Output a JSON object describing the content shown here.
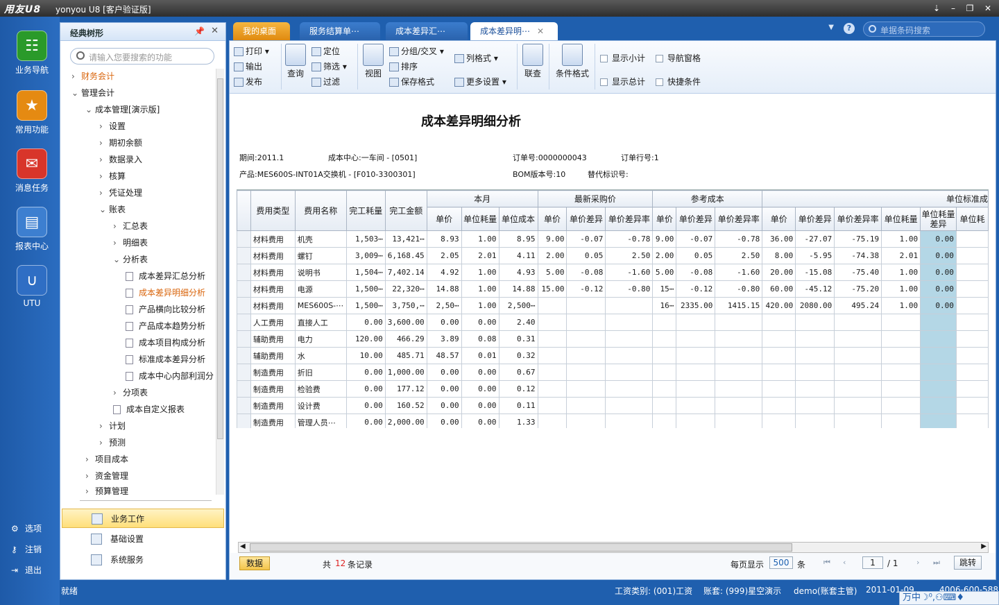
{
  "window": {
    "logo": "用友U8",
    "title": "yonyou U8 [客户验证版]",
    "controls": [
      "⇣",
      "–",
      "❐",
      "✕"
    ]
  },
  "leftnav": {
    "items": [
      {
        "label": "业务导航",
        "icon": "business-nav-icon",
        "color": "#2a9a2a"
      },
      {
        "label": "常用功能",
        "icon": "star-icon",
        "color": "#e58a12"
      },
      {
        "label": "消息任务",
        "icon": "mail-icon",
        "color": "#d8352a"
      },
      {
        "label": "报表中心",
        "icon": "report-icon",
        "color": "#3d7fd0"
      },
      {
        "label": "UTU",
        "icon": "utu-icon",
        "color": "#2f6ec4"
      }
    ],
    "bottom": [
      "选项",
      "注销",
      "退出"
    ]
  },
  "tree": {
    "title": "经典树形",
    "search_placeholder": "请输入您要搜索的功能",
    "nodes": [
      {
        "label": "财务会计",
        "arrow": "›"
      },
      {
        "label": "管理会计",
        "arrow": "⌄"
      },
      {
        "label": "成本管理[演示版]",
        "arrow": "⌄"
      },
      {
        "label": "设置",
        "arrow": "›"
      },
      {
        "label": "期初余额",
        "arrow": "›"
      },
      {
        "label": "数据录入",
        "arrow": "›"
      },
      {
        "label": "核算",
        "arrow": "›"
      },
      {
        "label": "凭证处理",
        "arrow": "›"
      },
      {
        "label": "账表",
        "arrow": "⌄"
      },
      {
        "label": "汇总表",
        "arrow": "›"
      },
      {
        "label": "明细表",
        "arrow": "›"
      },
      {
        "label": "分析表",
        "arrow": "⌄"
      },
      {
        "label": "成本差异汇总分析",
        "arrow": ""
      },
      {
        "label": "成本差异明细分析",
        "arrow": ""
      },
      {
        "label": "产品横向比较分析",
        "arrow": ""
      },
      {
        "label": "产品成本趋势分析",
        "arrow": ""
      },
      {
        "label": "成本项目构成分析",
        "arrow": ""
      },
      {
        "label": "标准成本差异分析",
        "arrow": ""
      },
      {
        "label": "成本中心内部利润分",
        "arrow": ""
      },
      {
        "label": "分项表",
        "arrow": "›"
      },
      {
        "label": "成本自定义报表",
        "arrow": ""
      },
      {
        "label": "计划",
        "arrow": "›"
      },
      {
        "label": "预测",
        "arrow": "›"
      },
      {
        "label": "项目成本",
        "arrow": "›"
      },
      {
        "label": "资金管理",
        "arrow": "›"
      },
      {
        "label": "预算管理",
        "arrow": "›"
      }
    ],
    "bottom_items": [
      "业务工作",
      "基础设置",
      "系统服务"
    ]
  },
  "tabs": [
    {
      "label": "我的桌面"
    },
    {
      "label": "服务结算单⋯"
    },
    {
      "label": "成本差异汇⋯"
    },
    {
      "label": "成本差异明⋯"
    }
  ],
  "topsearch": {
    "placeholder": "单据条码搜索"
  },
  "toolbar": {
    "print": "打印",
    "export": "输出",
    "publish": "发布",
    "query": "查询",
    "locate": "定位",
    "filter": "筛选",
    "filter2": "过滤",
    "view": "视图",
    "group": "分组/交叉",
    "sort": "排序",
    "save_format": "保存格式",
    "col_format": "列格式",
    "more_settings": "更多设置",
    "link": "联查",
    "cond_format": "条件格式",
    "show_subtotal": "显示小计",
    "nav_pane": "导航窗格",
    "show_total": "显示总计",
    "quick_cond": "快捷条件"
  },
  "report": {
    "title": "成本差异明细分析",
    "period": "期间:2011.1",
    "cost_center": "成本中心:一车间 - [0501]",
    "order_no": "订单号:0000000043",
    "order_line": "订单行号:1",
    "product": "产品:MES600S-INT01A交换机 - [F010-3300301]",
    "bom": "BOM版本号:10",
    "alt": "替代标识号:"
  },
  "table": {
    "group_headers": [
      "本月",
      "最新采购价",
      "参考成本",
      "单位标准成"
    ],
    "headers": [
      "费用类型",
      "费用名称",
      "完工耗量",
      "完工金额",
      "单价",
      "单位耗量",
      "单位成本",
      "单价",
      "单价差异",
      "单价差异率",
      "单价",
      "单价差异",
      "单价差异率",
      "单价",
      "单价差异",
      "单价差异率",
      "单位耗量",
      "单位耗量差异",
      "单位耗"
    ],
    "rows": [
      [
        "材料费用",
        "机壳",
        "1,503⋯",
        "13,421⋯",
        "8.93",
        "1.00",
        "8.95",
        "9.00",
        "-0.07",
        "-0.78",
        "9.00",
        "-0.07",
        "-0.78",
        "36.00",
        "-27.07",
        "-75.19",
        "1.00",
        "0.00",
        ""
      ],
      [
        "材料费用",
        "螺钉",
        "3,009⋯",
        "6,168.45",
        "2.05",
        "2.01",
        "4.11",
        "2.00",
        "0.05",
        "2.50",
        "2.00",
        "0.05",
        "2.50",
        "8.00",
        "-5.95",
        "-74.38",
        "2.01",
        "0.00",
        ""
      ],
      [
        "材料费用",
        "说明书",
        "1,504⋯",
        "7,402.14",
        "4.92",
        "1.00",
        "4.93",
        "5.00",
        "-0.08",
        "-1.60",
        "5.00",
        "-0.08",
        "-1.60",
        "20.00",
        "-15.08",
        "-75.40",
        "1.00",
        "0.00",
        ""
      ],
      [
        "材料费用",
        "电源",
        "1,500⋯",
        "22,320⋯",
        "14.88",
        "1.00",
        "14.88",
        "15.00",
        "-0.12",
        "-0.80",
        "15⋯",
        "-0.12",
        "-0.80",
        "60.00",
        "-45.12",
        "-75.20",
        "1.00",
        "0.00",
        ""
      ],
      [
        "材料费用",
        "MES600S-⋯",
        "1,500⋯",
        "3,750,⋯",
        "2,50⋯",
        "1.00",
        "2,500⋯",
        "",
        "",
        "",
        "16⋯",
        "2335.00",
        "1415.15",
        "420.00",
        "2080.00",
        "495.24",
        "1.00",
        "0.00",
        ""
      ],
      [
        "人工费用",
        "直接人工",
        "0.00",
        "3,600.00",
        "0.00",
        "0.00",
        "2.40",
        "",
        "",
        "",
        "",
        "",
        "",
        "",
        "",
        "",
        "",
        "",
        ""
      ],
      [
        "辅助费用",
        "电力",
        "120.00",
        "466.29",
        "3.89",
        "0.08",
        "0.31",
        "",
        "",
        "",
        "",
        "",
        "",
        "",
        "",
        "",
        "",
        "",
        ""
      ],
      [
        "辅助费用",
        "水",
        "10.00",
        "485.71",
        "48.57",
        "0.01",
        "0.32",
        "",
        "",
        "",
        "",
        "",
        "",
        "",
        "",
        "",
        "",
        "",
        ""
      ],
      [
        "制造费用",
        "折旧",
        "0.00",
        "1,000.00",
        "0.00",
        "0.00",
        "0.67",
        "",
        "",
        "",
        "",
        "",
        "",
        "",
        "",
        "",
        "",
        "",
        ""
      ],
      [
        "制造费用",
        "检验费",
        "0.00",
        "177.12",
        "0.00",
        "0.00",
        "0.12",
        "",
        "",
        "",
        "",
        "",
        "",
        "",
        "",
        "",
        "",
        "",
        ""
      ],
      [
        "制造费用",
        "设计费",
        "0.00",
        "160.52",
        "0.00",
        "0.00",
        "0.11",
        "",
        "",
        "",
        "",
        "",
        "",
        "",
        "",
        "",
        "",
        "",
        ""
      ],
      [
        "制造费用",
        "管理人员⋯",
        "0.00",
        "2,000.00",
        "0.00",
        "0.00",
        "1.33",
        "",
        "",
        "",
        "",
        "",
        "",
        "",
        "",
        "",
        "",
        "",
        ""
      ]
    ]
  },
  "footer": {
    "data_btn": "数据",
    "total_prefix": "共",
    "total_count": "12",
    "total_suffix": "条记录",
    "per_page_label": "每页显示",
    "per_page": "500",
    "per_page_unit": "条",
    "page": "1",
    "pages": "/ 1",
    "jump": "跳转"
  },
  "statusbar": {
    "ready": "就绪",
    "wage_type": "工资类别: (001)工资",
    "account": "账套: (999)星空演示",
    "user": "demo(账套主管)",
    "date": "2011-01-09",
    "phone": "4006-600-588"
  },
  "ime": {
    "text": "万中☽⁰,⚇⌨♦"
  }
}
